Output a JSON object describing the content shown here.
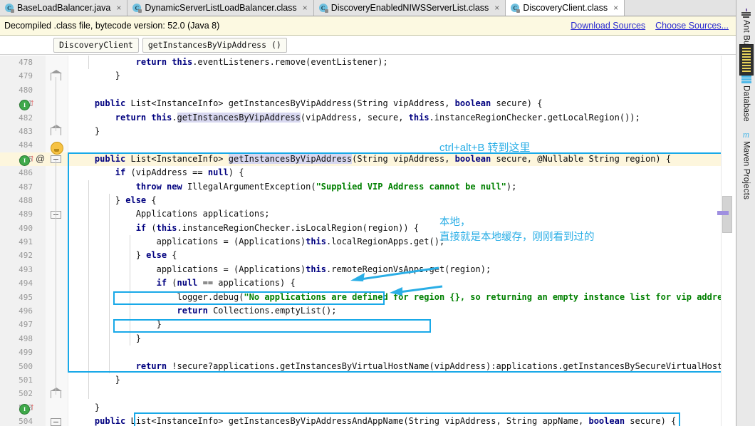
{
  "window": {
    "title": "DiscoveryClient.class"
  },
  "tabs": [
    {
      "label": "BaseLoadBalancer.java",
      "icon": "java-class-icon",
      "active": false,
      "close": "×"
    },
    {
      "label": "DynamicServerListLoadBalancer.class",
      "icon": "java-class-icon",
      "active": false,
      "close": "×"
    },
    {
      "label": "DiscoveryEnabledNIWSServerList.class",
      "icon": "java-class-icon",
      "active": false,
      "close": "×"
    },
    {
      "label": "DiscoveryClient.class",
      "icon": "java-class-icon",
      "active": true,
      "close": "×"
    }
  ],
  "notice": {
    "text": "Decompiled .class file, bytecode version: 52.0 (Java 8)",
    "links": [
      {
        "label": "Download Sources"
      },
      {
        "label": "Choose Sources..."
      }
    ]
  },
  "breadcrumb": [
    {
      "label": "DiscoveryClient"
    },
    {
      "label": "getInstancesByVipAddress ()"
    }
  ],
  "editor": {
    "first_line": 478,
    "lines": [
      {
        "n": "478",
        "html": "            <span class='kw'>return</span> <span class='kw'>this</span>.eventListeners.remove(eventListener);"
      },
      {
        "n": "479",
        "html": "        }"
      },
      {
        "n": "480",
        "html": ""
      },
      {
        "n": "481",
        "html": "    <span class='kw'>public</span> List&lt;InstanceInfo&gt; getInstancesByVipAddress(String vipAddress, <span class='kw'>boolean</span> secure) {"
      },
      {
        "n": "482",
        "html": "        <span class='kw'>return</span> <span class='kw'>this</span>.<span class='sel'>getInstancesByVipAddress</span>(vipAddress, secure, <span class='kw'>this</span>.instanceRegionChecker.getLocalRegion());"
      },
      {
        "n": "483",
        "html": "    }"
      },
      {
        "n": "484",
        "html": ""
      },
      {
        "n": "485",
        "html": "    <span class='kw'>public</span> List&lt;InstanceInfo&gt; <span class='sel'>getInstancesByVipAddress</span>(String vipAddress, <span class='kw'>boolean</span> secure, @Nullable String region) {"
      },
      {
        "n": "486",
        "html": "        <span class='kw'>if</span> (vipAddress == <span class='kw'>null</span>) {"
      },
      {
        "n": "487",
        "html": "            <span class='kw'>throw new</span> IllegalArgumentException(<span class='str'>\"Supplied VIP Address cannot be null\"</span>);"
      },
      {
        "n": "488",
        "html": "        } <span class='kw'>else</span> {"
      },
      {
        "n": "489",
        "html": "            Applications applications;"
      },
      {
        "n": "490",
        "html": "            <span class='kw'>if</span> (<span class='kw'>this</span>.instanceRegionChecker.isLocalRegion(region)) {"
      },
      {
        "n": "491",
        "html": "                applications = (Applications)<span class='kw'>this</span>.localRegionApps.get();"
      },
      {
        "n": "492",
        "html": "            } <span class='kw'>else</span> {"
      },
      {
        "n": "493",
        "html": "                applications = (Applications)<span class='kw'>this</span>.remoteRegionVsApps.get(region);"
      },
      {
        "n": "494",
        "html": "                <span class='kw'>if</span> (<span class='kw'>null</span> == applications) {"
      },
      {
        "n": "495",
        "html": "                    logger.debug(<span class='str'>\"No applications are defined for region {}, so returning an empty instance list for vip address {}.\"</span>, region,"
      },
      {
        "n": "496",
        "html": "                    <span class='kw'>return</span> Collections.emptyList();"
      },
      {
        "n": "497",
        "html": "                }"
      },
      {
        "n": "498",
        "html": "            }"
      },
      {
        "n": "499",
        "html": ""
      },
      {
        "n": "500",
        "html": "            <span class='kw'>return</span> !secure?applications.getInstancesByVirtualHostName(vipAddress):applications.getInstancesBySecureVirtualHostName(vipAddress);"
      },
      {
        "n": "501",
        "html": "        }"
      },
      {
        "n": "502",
        "html": ""
      },
      {
        "n": "503",
        "html": "    }"
      },
      {
        "n": "504",
        "html": "    <span class='kw'>public</span> List&lt;InstanceInfo&gt; getInstancesByVipAddressAndAppName(String vipAddress, String appName, <span class='kw'>boolean</span> secure) {"
      }
    ]
  },
  "annotations": {
    "shortcut_hint": "ctrl+alt+B 转到这里",
    "note_line1": "本地，",
    "note_line2": "直接就是本地缓存，刚刚看到过的",
    "accent_color": "#19a9e8"
  },
  "gutter_icons": [
    {
      "line": "481",
      "icons": [
        "implementation-marker-icon",
        "override-arrow-icon"
      ]
    },
    {
      "line": "485",
      "icons": [
        "implementation-marker-icon",
        "override-arrow-icon",
        "annotation-at-icon"
      ]
    },
    {
      "line": "504",
      "icons": [
        "implementation-marker-icon",
        "override-arrow-icon"
      ]
    }
  ],
  "tool_windows": [
    {
      "label": "Ant Build",
      "icon": "ant-build-icon"
    },
    {
      "label": "Database",
      "icon": "database-icon"
    },
    {
      "label": "Maven Projects",
      "icon": "maven-icon"
    }
  ],
  "colors": {
    "accent": "#19a9e8",
    "keyword": "#00007f",
    "string": "#008000",
    "notice_bg": "#fcf9e1",
    "highlight_row": "#fdf6dd",
    "link": "#2a2ad0"
  }
}
